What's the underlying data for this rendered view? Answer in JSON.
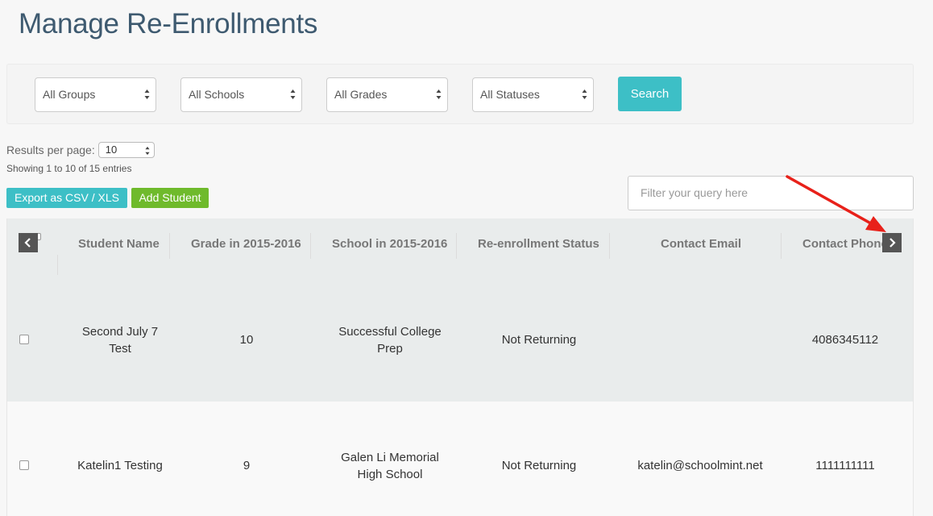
{
  "page": {
    "title": "Manage Re-Enrollments"
  },
  "filters": {
    "groups": "All Groups",
    "schools": "All Schools",
    "grades": "All Grades",
    "statuses": "All Statuses",
    "search_label": "Search"
  },
  "pagination": {
    "results_label": "Results per page:",
    "results_value": "10",
    "showing": "Showing 1 to 10 of 15 entries"
  },
  "actions": {
    "export_label": "Export as CSV / XLS",
    "add_label": "Add Student"
  },
  "query": {
    "placeholder": "Filter your query here"
  },
  "table": {
    "columns": [
      "Student Name",
      "Grade in 2015-2016",
      "School in 2015-2016",
      "Re-enrollment Status",
      "Contact Email",
      "Contact Phone"
    ],
    "rows": [
      {
        "name_line1": "Second July 7",
        "name_line2": "Test",
        "grade": "10",
        "school_line1": "Successful College",
        "school_line2": "Prep",
        "status": "Not Returning",
        "email": "",
        "phone": "4086345112"
      },
      {
        "name_line1": "Katelin1 Testing",
        "name_line2": "",
        "grade": "9",
        "school_line1": "Galen Li Memorial",
        "school_line2": "High School",
        "status": "Not Returning",
        "email": "katelin@schoolmint.net",
        "phone": "1111111111"
      }
    ]
  },
  "icons": {
    "prev": "chevron-left-icon",
    "next": "chevron-right-icon"
  },
  "colors": {
    "accent": "#3dbfc6",
    "add_green": "#6fba2c",
    "annotation_arrow": "#e8211a",
    "title": "#3e5a70"
  }
}
